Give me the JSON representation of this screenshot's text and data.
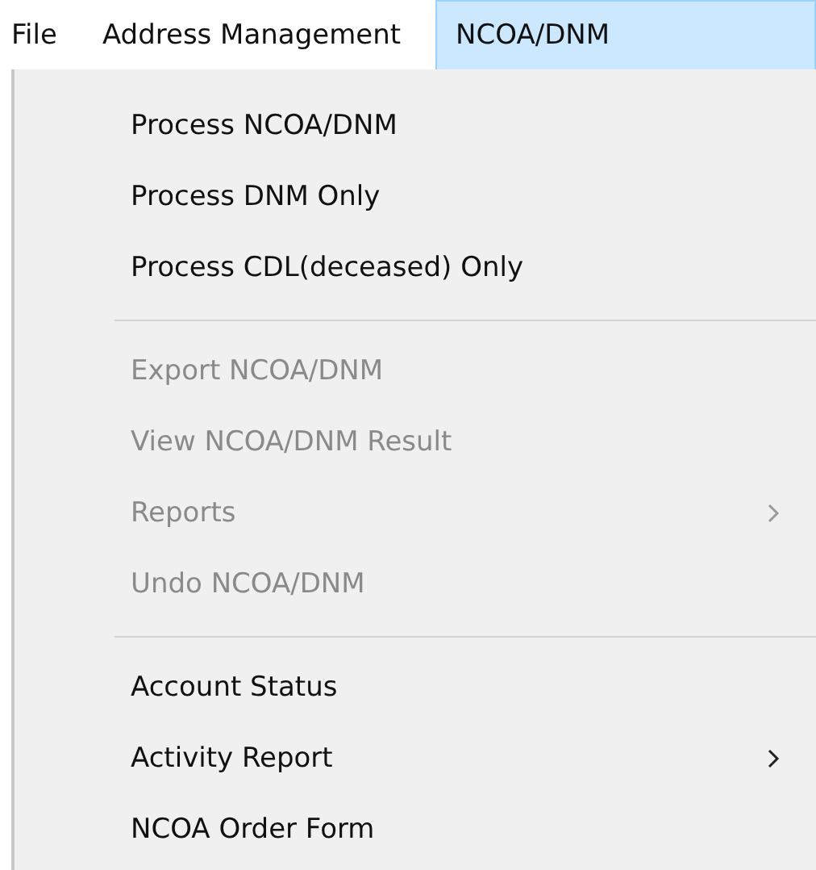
{
  "menubar": [
    {
      "label": "File",
      "selected": false
    },
    {
      "label": "Address Management",
      "selected": false
    },
    {
      "label": "NCOA/DNM",
      "selected": true
    }
  ],
  "menu": {
    "groups": [
      {
        "items": [
          {
            "label": "Process NCOA/DNM",
            "disabled": false,
            "submenu": false
          },
          {
            "label": "Process DNM Only",
            "disabled": false,
            "submenu": false
          },
          {
            "label": "Process CDL(deceased) Only",
            "disabled": false,
            "submenu": false
          }
        ]
      },
      {
        "items": [
          {
            "label": "Export NCOA/DNM",
            "disabled": true,
            "submenu": false
          },
          {
            "label": "View NCOA/DNM Result",
            "disabled": true,
            "submenu": false
          },
          {
            "label": "Reports",
            "disabled": true,
            "submenu": true
          },
          {
            "label": "Undo NCOA/DNM",
            "disabled": true,
            "submenu": false
          }
        ]
      },
      {
        "items": [
          {
            "label": "Account Status",
            "disabled": false,
            "submenu": false
          },
          {
            "label": "Activity Report",
            "disabled": false,
            "submenu": true
          },
          {
            "label": "NCOA Order Form",
            "disabled": false,
            "submenu": false
          }
        ]
      }
    ]
  }
}
